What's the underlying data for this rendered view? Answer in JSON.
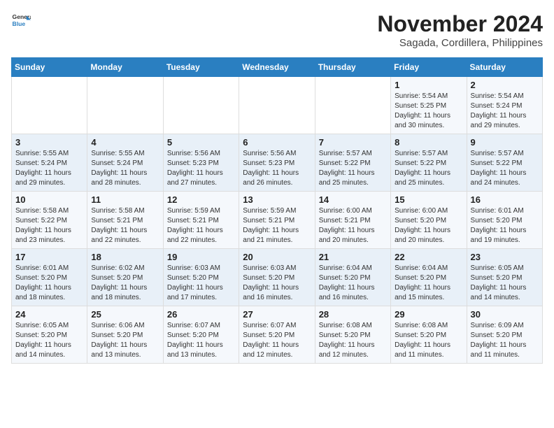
{
  "header": {
    "logo_line1": "General",
    "logo_line2": "Blue",
    "month": "November 2024",
    "location": "Sagada, Cordillera, Philippines"
  },
  "weekdays": [
    "Sunday",
    "Monday",
    "Tuesday",
    "Wednesday",
    "Thursday",
    "Friday",
    "Saturday"
  ],
  "weeks": [
    [
      {
        "day": "",
        "sunrise": "",
        "sunset": "",
        "daylight": ""
      },
      {
        "day": "",
        "sunrise": "",
        "sunset": "",
        "daylight": ""
      },
      {
        "day": "",
        "sunrise": "",
        "sunset": "",
        "daylight": ""
      },
      {
        "day": "",
        "sunrise": "",
        "sunset": "",
        "daylight": ""
      },
      {
        "day": "",
        "sunrise": "",
        "sunset": "",
        "daylight": ""
      },
      {
        "day": "1",
        "sunrise": "Sunrise: 5:54 AM",
        "sunset": "Sunset: 5:25 PM",
        "daylight": "Daylight: 11 hours and 30 minutes."
      },
      {
        "day": "2",
        "sunrise": "Sunrise: 5:54 AM",
        "sunset": "Sunset: 5:24 PM",
        "daylight": "Daylight: 11 hours and 29 minutes."
      }
    ],
    [
      {
        "day": "3",
        "sunrise": "Sunrise: 5:55 AM",
        "sunset": "Sunset: 5:24 PM",
        "daylight": "Daylight: 11 hours and 29 minutes."
      },
      {
        "day": "4",
        "sunrise": "Sunrise: 5:55 AM",
        "sunset": "Sunset: 5:24 PM",
        "daylight": "Daylight: 11 hours and 28 minutes."
      },
      {
        "day": "5",
        "sunrise": "Sunrise: 5:56 AM",
        "sunset": "Sunset: 5:23 PM",
        "daylight": "Daylight: 11 hours and 27 minutes."
      },
      {
        "day": "6",
        "sunrise": "Sunrise: 5:56 AM",
        "sunset": "Sunset: 5:23 PM",
        "daylight": "Daylight: 11 hours and 26 minutes."
      },
      {
        "day": "7",
        "sunrise": "Sunrise: 5:57 AM",
        "sunset": "Sunset: 5:22 PM",
        "daylight": "Daylight: 11 hours and 25 minutes."
      },
      {
        "day": "8",
        "sunrise": "Sunrise: 5:57 AM",
        "sunset": "Sunset: 5:22 PM",
        "daylight": "Daylight: 11 hours and 25 minutes."
      },
      {
        "day": "9",
        "sunrise": "Sunrise: 5:57 AM",
        "sunset": "Sunset: 5:22 PM",
        "daylight": "Daylight: 11 hours and 24 minutes."
      }
    ],
    [
      {
        "day": "10",
        "sunrise": "Sunrise: 5:58 AM",
        "sunset": "Sunset: 5:22 PM",
        "daylight": "Daylight: 11 hours and 23 minutes."
      },
      {
        "day": "11",
        "sunrise": "Sunrise: 5:58 AM",
        "sunset": "Sunset: 5:21 PM",
        "daylight": "Daylight: 11 hours and 22 minutes."
      },
      {
        "day": "12",
        "sunrise": "Sunrise: 5:59 AM",
        "sunset": "Sunset: 5:21 PM",
        "daylight": "Daylight: 11 hours and 22 minutes."
      },
      {
        "day": "13",
        "sunrise": "Sunrise: 5:59 AM",
        "sunset": "Sunset: 5:21 PM",
        "daylight": "Daylight: 11 hours and 21 minutes."
      },
      {
        "day": "14",
        "sunrise": "Sunrise: 6:00 AM",
        "sunset": "Sunset: 5:21 PM",
        "daylight": "Daylight: 11 hours and 20 minutes."
      },
      {
        "day": "15",
        "sunrise": "Sunrise: 6:00 AM",
        "sunset": "Sunset: 5:20 PM",
        "daylight": "Daylight: 11 hours and 20 minutes."
      },
      {
        "day": "16",
        "sunrise": "Sunrise: 6:01 AM",
        "sunset": "Sunset: 5:20 PM",
        "daylight": "Daylight: 11 hours and 19 minutes."
      }
    ],
    [
      {
        "day": "17",
        "sunrise": "Sunrise: 6:01 AM",
        "sunset": "Sunset: 5:20 PM",
        "daylight": "Daylight: 11 hours and 18 minutes."
      },
      {
        "day": "18",
        "sunrise": "Sunrise: 6:02 AM",
        "sunset": "Sunset: 5:20 PM",
        "daylight": "Daylight: 11 hours and 18 minutes."
      },
      {
        "day": "19",
        "sunrise": "Sunrise: 6:03 AM",
        "sunset": "Sunset: 5:20 PM",
        "daylight": "Daylight: 11 hours and 17 minutes."
      },
      {
        "day": "20",
        "sunrise": "Sunrise: 6:03 AM",
        "sunset": "Sunset: 5:20 PM",
        "daylight": "Daylight: 11 hours and 16 minutes."
      },
      {
        "day": "21",
        "sunrise": "Sunrise: 6:04 AM",
        "sunset": "Sunset: 5:20 PM",
        "daylight": "Daylight: 11 hours and 16 minutes."
      },
      {
        "day": "22",
        "sunrise": "Sunrise: 6:04 AM",
        "sunset": "Sunset: 5:20 PM",
        "daylight": "Daylight: 11 hours and 15 minutes."
      },
      {
        "day": "23",
        "sunrise": "Sunrise: 6:05 AM",
        "sunset": "Sunset: 5:20 PM",
        "daylight": "Daylight: 11 hours and 14 minutes."
      }
    ],
    [
      {
        "day": "24",
        "sunrise": "Sunrise: 6:05 AM",
        "sunset": "Sunset: 5:20 PM",
        "daylight": "Daylight: 11 hours and 14 minutes."
      },
      {
        "day": "25",
        "sunrise": "Sunrise: 6:06 AM",
        "sunset": "Sunset: 5:20 PM",
        "daylight": "Daylight: 11 hours and 13 minutes."
      },
      {
        "day": "26",
        "sunrise": "Sunrise: 6:07 AM",
        "sunset": "Sunset: 5:20 PM",
        "daylight": "Daylight: 11 hours and 13 minutes."
      },
      {
        "day": "27",
        "sunrise": "Sunrise: 6:07 AM",
        "sunset": "Sunset: 5:20 PM",
        "daylight": "Daylight: 11 hours and 12 minutes."
      },
      {
        "day": "28",
        "sunrise": "Sunrise: 6:08 AM",
        "sunset": "Sunset: 5:20 PM",
        "daylight": "Daylight: 11 hours and 12 minutes."
      },
      {
        "day": "29",
        "sunrise": "Sunrise: 6:08 AM",
        "sunset": "Sunset: 5:20 PM",
        "daylight": "Daylight: 11 hours and 11 minutes."
      },
      {
        "day": "30",
        "sunrise": "Sunrise: 6:09 AM",
        "sunset": "Sunset: 5:20 PM",
        "daylight": "Daylight: 11 hours and 11 minutes."
      }
    ]
  ]
}
